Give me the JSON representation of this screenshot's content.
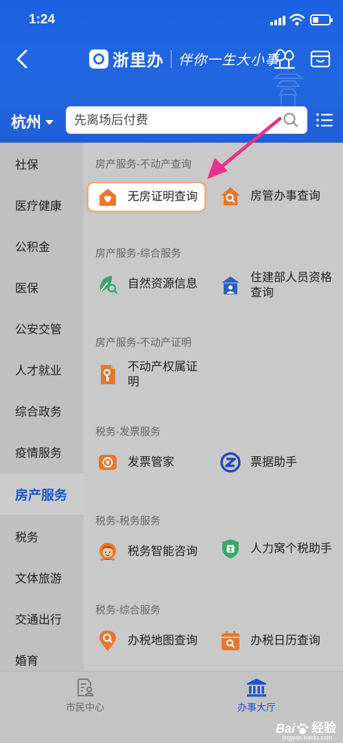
{
  "status_bar": {
    "time": "1:24"
  },
  "header": {
    "app_name": "浙里办",
    "slogan": "伴你一生大小事",
    "city": "杭州",
    "search_placeholder": "先离场后付费"
  },
  "sidebar": {
    "items": [
      {
        "label": "社保",
        "active": false
      },
      {
        "label": "医疗健康",
        "active": false
      },
      {
        "label": "公积金",
        "active": false
      },
      {
        "label": "医保",
        "active": false
      },
      {
        "label": "公安交管",
        "active": false
      },
      {
        "label": "人才就业",
        "active": false
      },
      {
        "label": "综合政务",
        "active": false
      },
      {
        "label": "疫情服务",
        "active": false
      },
      {
        "label": "房产服务",
        "active": true
      },
      {
        "label": "税务",
        "active": false
      },
      {
        "label": "文体旅游",
        "active": false
      },
      {
        "label": "交通出行",
        "active": false
      },
      {
        "label": "婚育",
        "active": false
      }
    ]
  },
  "sections": [
    {
      "title": "房产服务-不动产查询",
      "services": [
        {
          "label": "无房证明查询",
          "icon": "house-heart-icon",
          "highlighted": true
        },
        {
          "label": "房管办事查询",
          "icon": "house-search-icon"
        }
      ]
    },
    {
      "title": "房产服务-综合服务",
      "services": [
        {
          "label": "自然资源信息",
          "icon": "leaf-search-icon"
        },
        {
          "label": "住建部人员资格查询",
          "icon": "building-person-icon"
        }
      ]
    },
    {
      "title": "房产服务-不动产证明",
      "services": [
        {
          "label": "不动产权属证明",
          "icon": "property-certificate-icon"
        }
      ]
    },
    {
      "title": "税务-发票服务",
      "services": [
        {
          "label": "发票管家",
          "icon": "invoice-icon"
        },
        {
          "label": "票据助手",
          "icon": "receipt-helper-icon"
        }
      ]
    },
    {
      "title": "税务-税务服务",
      "services": [
        {
          "label": "税务智能咨询",
          "icon": "tax-consultant-icon"
        },
        {
          "label": "人力窝个税助手",
          "icon": "tax-shield-icon"
        }
      ]
    },
    {
      "title": "税务-综合服务",
      "services": [
        {
          "label": "办税地图查询",
          "icon": "map-pin-search-icon"
        },
        {
          "label": "办税日历查询",
          "icon": "calendar-search-icon"
        }
      ]
    }
  ],
  "tabbar": {
    "tabs": [
      {
        "label": "市民中心",
        "icon": "citizen-center-icon",
        "active": false
      },
      {
        "label": "办事大厅",
        "icon": "service-hall-icon",
        "active": true
      }
    ]
  },
  "watermark": {
    "brand": "Bai",
    "suffix": "经验",
    "url": "jingyan.baidu.com"
  },
  "colors": {
    "header_blue": "#1f63de",
    "active_blue": "#1c56cc",
    "icon_orange": "#e6772e",
    "icon_green": "#3aa56b",
    "annotation_pink": "#e8338a"
  }
}
